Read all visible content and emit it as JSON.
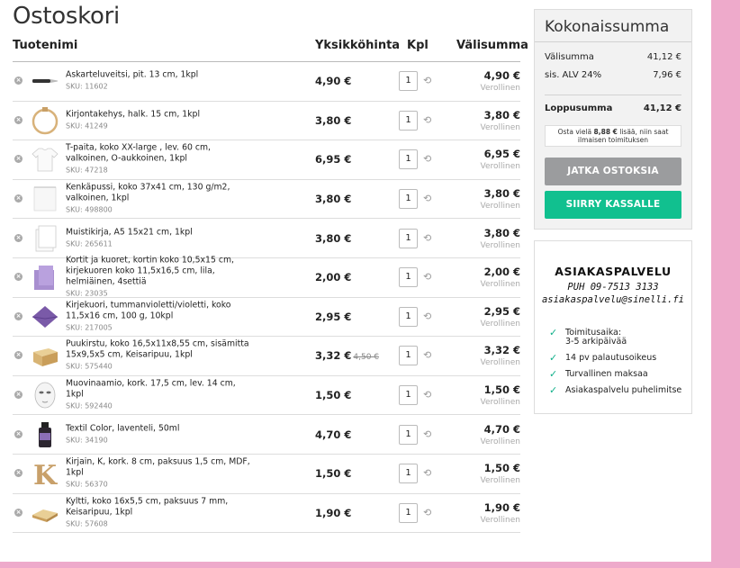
{
  "page_title": "Ostoskori",
  "columns": {
    "name": "Tuotenimi",
    "unit_price": "Yksikköhinta",
    "qty": "Kpl",
    "subtotal": "Välisumma"
  },
  "items": [
    {
      "name": "Askarteluveitsi, pit. 13 cm, 1kpl",
      "sku": "SKU: 11602",
      "unit": "4,90 €",
      "old": "",
      "qty": "1",
      "total": "4,90 €",
      "total_label": "Verollinen",
      "thumb": "knife"
    },
    {
      "name": "Kirjontakehys, halk. 15 cm, 1kpl",
      "sku": "SKU: 41249",
      "unit": "3,80 €",
      "old": "",
      "qty": "1",
      "total": "3,80 €",
      "total_label": "Verollinen",
      "thumb": "hoop"
    },
    {
      "name": "T-paita, koko XX-large , lev. 60 cm, valkoinen, O-aukkoinen, 1kpl",
      "sku": "SKU: 47218",
      "unit": "6,95 €",
      "old": "",
      "qty": "1",
      "total": "6,95 €",
      "total_label": "Verollinen",
      "thumb": "tshirt"
    },
    {
      "name": "Kenkäpussi, koko 37x41 cm, 130 g/m2, valkoinen, 1kpl",
      "sku": "SKU: 498800",
      "unit": "3,80 €",
      "old": "",
      "qty": "1",
      "total": "3,80 €",
      "total_label": "Verollinen",
      "thumb": "bag"
    },
    {
      "name": "Muistikirja, A5 15x21 cm, 1kpl",
      "sku": "SKU: 265611",
      "unit": "3,80 €",
      "old": "",
      "qty": "1",
      "total": "3,80 €",
      "total_label": "Verollinen",
      "thumb": "notebook"
    },
    {
      "name": "Kortit ja kuoret, kortin koko 10,5x15 cm, kirjekuoren koko 11,5x16,5 cm, lila, helmiäinen, 4settiä",
      "sku": "SKU: 23035",
      "unit": "2,00 €",
      "old": "",
      "qty": "1",
      "total": "2,00 €",
      "total_label": "Verollinen",
      "thumb": "cards"
    },
    {
      "name": "Kirjekuori, tummanvioletti/violetti, koko 11,5x16 cm, 100 g, 10kpl",
      "sku": "SKU: 217005",
      "unit": "2,95 €",
      "old": "",
      "qty": "1",
      "total": "2,95 €",
      "total_label": "Verollinen",
      "thumb": "envelope"
    },
    {
      "name": "Puukirstu, koko 16,5x11x8,55 cm, sisämitta 15x9,5x5 cm, Keisaripuu, 1kpl",
      "sku": "SKU: 575440",
      "unit": "3,32 €",
      "old": "4,50 €",
      "qty": "1",
      "total": "3,32 €",
      "total_label": "Verollinen",
      "thumb": "chest"
    },
    {
      "name": "Muovinaamio, kork. 17,5 cm, lev. 14 cm, 1kpl",
      "sku": "SKU: 592440",
      "unit": "1,50 €",
      "old": "",
      "qty": "1",
      "total": "1,50 €",
      "total_label": "Verollinen",
      "thumb": "mask"
    },
    {
      "name": "Textil Color, laventeli, 50ml",
      "sku": "SKU: 34190",
      "unit": "4,70 €",
      "old": "",
      "qty": "1",
      "total": "4,70 €",
      "total_label": "Verollinen",
      "thumb": "bottle"
    },
    {
      "name": "Kirjain, K, kork. 8 cm, paksuus 1,5 cm, MDF, 1kpl",
      "sku": "SKU: 56370",
      "unit": "1,50 €",
      "old": "",
      "qty": "1",
      "total": "1,50 €",
      "total_label": "Verollinen",
      "thumb": "letter"
    },
    {
      "name": "Kyltti, koko 16x5,5 cm, paksuus 7 mm, Keisaripuu, 1kpl",
      "sku": "SKU: 57608",
      "unit": "1,90 €",
      "old": "",
      "qty": "1",
      "total": "1,90 €",
      "total_label": "Verollinen",
      "thumb": "sign"
    }
  ],
  "summary": {
    "title": "Kokonaissumma",
    "subtotal_label": "Välisumma",
    "subtotal_value": "41,12 €",
    "vat_label": "sis. ALV 24%",
    "vat_value": "7,96 €",
    "total_label": "Loppusumma",
    "total_value": "41,12 €",
    "free_ship_prefix": "Osta vielä ",
    "free_ship_amount": "8,88 €",
    "free_ship_suffix": " lisää, niin saat ilmaisen toimituksen",
    "continue_label": "JATKA OSTOKSIA",
    "checkout_label": "SIIRRY KASSALLE"
  },
  "service": {
    "title": "ASIAKASPALVELU",
    "phone": "PUH 09-7513 3133",
    "email": "asiakaspalvelu@sinelli.fi",
    "features": [
      "Toimitusaika:\n3-5 arkipäivää",
      "14 pv palautusoikeus",
      "Turvallinen maksaa",
      "Asiakaspalvelu puhelimitse"
    ]
  },
  "colors": {
    "checkout": "#11c08f",
    "continue": "#9b9c9e",
    "background": "#eeaacb"
  }
}
